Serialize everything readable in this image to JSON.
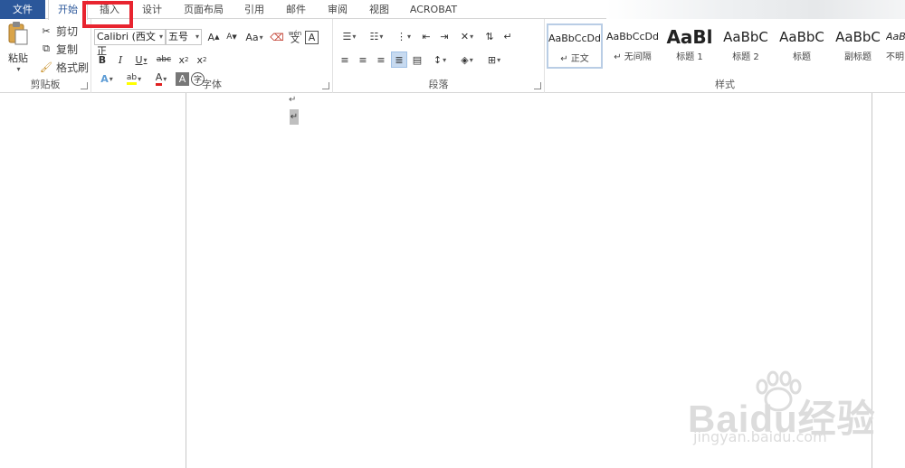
{
  "tabs": [
    {
      "id": "file",
      "label": "文件"
    },
    {
      "id": "home",
      "label": "开始"
    },
    {
      "id": "insert",
      "label": "插入"
    },
    {
      "id": "design",
      "label": "设计"
    },
    {
      "id": "layout",
      "label": "页面布局"
    },
    {
      "id": "references",
      "label": "引用"
    },
    {
      "id": "mailings",
      "label": "邮件"
    },
    {
      "id": "review",
      "label": "审阅"
    },
    {
      "id": "view",
      "label": "视图"
    },
    {
      "id": "acrobat",
      "label": "ACROBAT"
    }
  ],
  "active_tab": "开始",
  "highlighted_tab": "插入",
  "highlight_color": "#e8242f",
  "accent_color": "#2b579a",
  "clipboard": {
    "paste_label": "粘贴",
    "cut_label": "剪切",
    "copy_label": "复制",
    "format_painter_label": "格式刷",
    "group_label": "剪贴板"
  },
  "font": {
    "font_name": "Calibri (西文正",
    "font_size": "五号",
    "grow_font": "A",
    "shrink_font": "A",
    "change_case": "Aa",
    "phonetic_top": "wén",
    "phonetic_bottom": "文",
    "char_border": "A",
    "bold": "B",
    "italic": "I",
    "underline": "U",
    "strikethrough": "abc",
    "subscript_base": "x",
    "subscript_mark": "2",
    "superscript_base": "x",
    "superscript_mark": "2",
    "text_effects": "A",
    "highlight": "ab",
    "font_color": "A",
    "char_shading": "A",
    "enclose_char": "字",
    "group_label": "字体"
  },
  "paragraph": {
    "group_label": "段落"
  },
  "styles": {
    "group_label": "样式",
    "items": [
      {
        "sample": "AaBbCcDd",
        "name": "↵ 正文"
      },
      {
        "sample": "AaBbCcDd",
        "name": "↵ 无间隔"
      },
      {
        "sample": "AaBl",
        "name": "标题 1"
      },
      {
        "sample": "AaBbC",
        "name": "标题 2"
      },
      {
        "sample": "AaBbC",
        "name": "标题"
      },
      {
        "sample": "AaBbC",
        "name": "副标题"
      },
      {
        "sample": "AaBl",
        "name": "不明"
      }
    ]
  },
  "document": {
    "para_mark": "↵",
    "cursor_mark": "↵"
  },
  "watermark": {
    "brand": "Baidu经验",
    "url": "jingyan.baidu.com"
  }
}
